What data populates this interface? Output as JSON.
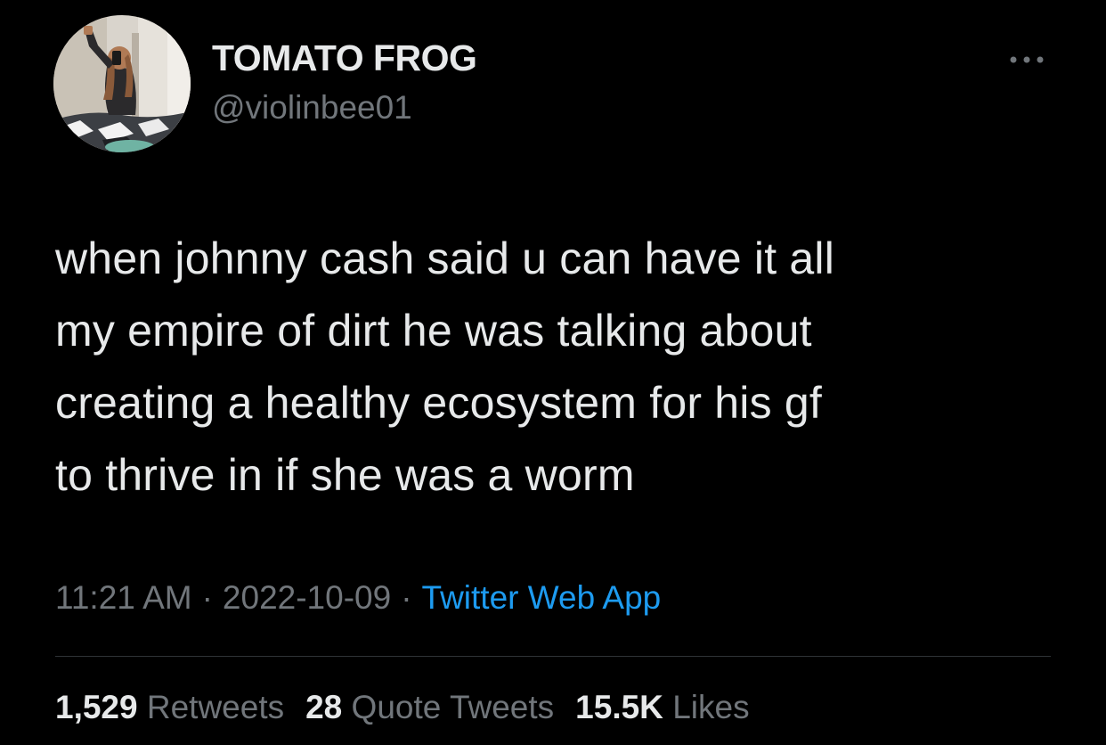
{
  "user": {
    "display_name": "TOMATO FROG",
    "handle": "@violinbee01"
  },
  "tweet": {
    "lines": [
      "when johnny cash said u can have it all",
      "my empire of dirt he was talking about",
      "creating a healthy ecosystem for his gf",
      "to thrive in if she was a worm"
    ],
    "time": "11:21 AM",
    "date": "2022-10-09",
    "separator": "·",
    "source": "Twitter Web App"
  },
  "stats": {
    "retweets_count": "1,529",
    "retweets_label": "Retweets",
    "quotes_count": "28",
    "quotes_label": "Quote Tweets",
    "likes_count": "15.5K",
    "likes_label": "Likes"
  },
  "icons": {
    "more": "more-options-icon"
  },
  "colors": {
    "background": "#000000",
    "text": "#e7e9ea",
    "secondary": "#71767b",
    "link": "#1d9bf0",
    "divider": "#2f3336"
  }
}
